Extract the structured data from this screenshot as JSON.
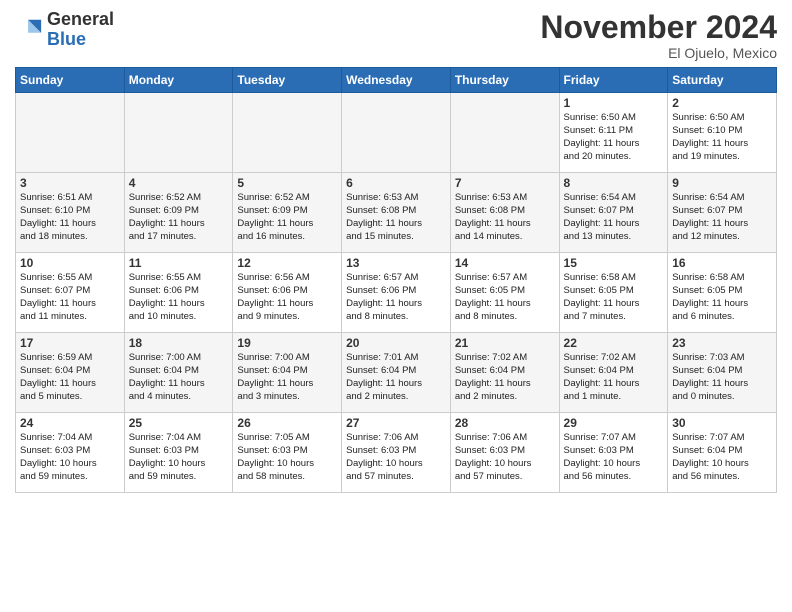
{
  "header": {
    "logo_general": "General",
    "logo_blue": "Blue",
    "month": "November 2024",
    "location": "El Ojuelo, Mexico"
  },
  "days_of_week": [
    "Sunday",
    "Monday",
    "Tuesday",
    "Wednesday",
    "Thursday",
    "Friday",
    "Saturday"
  ],
  "weeks": [
    [
      {
        "day": "",
        "info": ""
      },
      {
        "day": "",
        "info": ""
      },
      {
        "day": "",
        "info": ""
      },
      {
        "day": "",
        "info": ""
      },
      {
        "day": "",
        "info": ""
      },
      {
        "day": "1",
        "info": "Sunrise: 6:50 AM\nSunset: 6:11 PM\nDaylight: 11 hours\nand 20 minutes."
      },
      {
        "day": "2",
        "info": "Sunrise: 6:50 AM\nSunset: 6:10 PM\nDaylight: 11 hours\nand 19 minutes."
      }
    ],
    [
      {
        "day": "3",
        "info": "Sunrise: 6:51 AM\nSunset: 6:10 PM\nDaylight: 11 hours\nand 18 minutes."
      },
      {
        "day": "4",
        "info": "Sunrise: 6:52 AM\nSunset: 6:09 PM\nDaylight: 11 hours\nand 17 minutes."
      },
      {
        "day": "5",
        "info": "Sunrise: 6:52 AM\nSunset: 6:09 PM\nDaylight: 11 hours\nand 16 minutes."
      },
      {
        "day": "6",
        "info": "Sunrise: 6:53 AM\nSunset: 6:08 PM\nDaylight: 11 hours\nand 15 minutes."
      },
      {
        "day": "7",
        "info": "Sunrise: 6:53 AM\nSunset: 6:08 PM\nDaylight: 11 hours\nand 14 minutes."
      },
      {
        "day": "8",
        "info": "Sunrise: 6:54 AM\nSunset: 6:07 PM\nDaylight: 11 hours\nand 13 minutes."
      },
      {
        "day": "9",
        "info": "Sunrise: 6:54 AM\nSunset: 6:07 PM\nDaylight: 11 hours\nand 12 minutes."
      }
    ],
    [
      {
        "day": "10",
        "info": "Sunrise: 6:55 AM\nSunset: 6:07 PM\nDaylight: 11 hours\nand 11 minutes."
      },
      {
        "day": "11",
        "info": "Sunrise: 6:55 AM\nSunset: 6:06 PM\nDaylight: 11 hours\nand 10 minutes."
      },
      {
        "day": "12",
        "info": "Sunrise: 6:56 AM\nSunset: 6:06 PM\nDaylight: 11 hours\nand 9 minutes."
      },
      {
        "day": "13",
        "info": "Sunrise: 6:57 AM\nSunset: 6:06 PM\nDaylight: 11 hours\nand 8 minutes."
      },
      {
        "day": "14",
        "info": "Sunrise: 6:57 AM\nSunset: 6:05 PM\nDaylight: 11 hours\nand 8 minutes."
      },
      {
        "day": "15",
        "info": "Sunrise: 6:58 AM\nSunset: 6:05 PM\nDaylight: 11 hours\nand 7 minutes."
      },
      {
        "day": "16",
        "info": "Sunrise: 6:58 AM\nSunset: 6:05 PM\nDaylight: 11 hours\nand 6 minutes."
      }
    ],
    [
      {
        "day": "17",
        "info": "Sunrise: 6:59 AM\nSunset: 6:04 PM\nDaylight: 11 hours\nand 5 minutes."
      },
      {
        "day": "18",
        "info": "Sunrise: 7:00 AM\nSunset: 6:04 PM\nDaylight: 11 hours\nand 4 minutes."
      },
      {
        "day": "19",
        "info": "Sunrise: 7:00 AM\nSunset: 6:04 PM\nDaylight: 11 hours\nand 3 minutes."
      },
      {
        "day": "20",
        "info": "Sunrise: 7:01 AM\nSunset: 6:04 PM\nDaylight: 11 hours\nand 2 minutes."
      },
      {
        "day": "21",
        "info": "Sunrise: 7:02 AM\nSunset: 6:04 PM\nDaylight: 11 hours\nand 2 minutes."
      },
      {
        "day": "22",
        "info": "Sunrise: 7:02 AM\nSunset: 6:04 PM\nDaylight: 11 hours\nand 1 minute."
      },
      {
        "day": "23",
        "info": "Sunrise: 7:03 AM\nSunset: 6:04 PM\nDaylight: 11 hours\nand 0 minutes."
      }
    ],
    [
      {
        "day": "24",
        "info": "Sunrise: 7:04 AM\nSunset: 6:03 PM\nDaylight: 10 hours\nand 59 minutes."
      },
      {
        "day": "25",
        "info": "Sunrise: 7:04 AM\nSunset: 6:03 PM\nDaylight: 10 hours\nand 59 minutes."
      },
      {
        "day": "26",
        "info": "Sunrise: 7:05 AM\nSunset: 6:03 PM\nDaylight: 10 hours\nand 58 minutes."
      },
      {
        "day": "27",
        "info": "Sunrise: 7:06 AM\nSunset: 6:03 PM\nDaylight: 10 hours\nand 57 minutes."
      },
      {
        "day": "28",
        "info": "Sunrise: 7:06 AM\nSunset: 6:03 PM\nDaylight: 10 hours\nand 57 minutes."
      },
      {
        "day": "29",
        "info": "Sunrise: 7:07 AM\nSunset: 6:03 PM\nDaylight: 10 hours\nand 56 minutes."
      },
      {
        "day": "30",
        "info": "Sunrise: 7:07 AM\nSunset: 6:04 PM\nDaylight: 10 hours\nand 56 minutes."
      }
    ]
  ]
}
